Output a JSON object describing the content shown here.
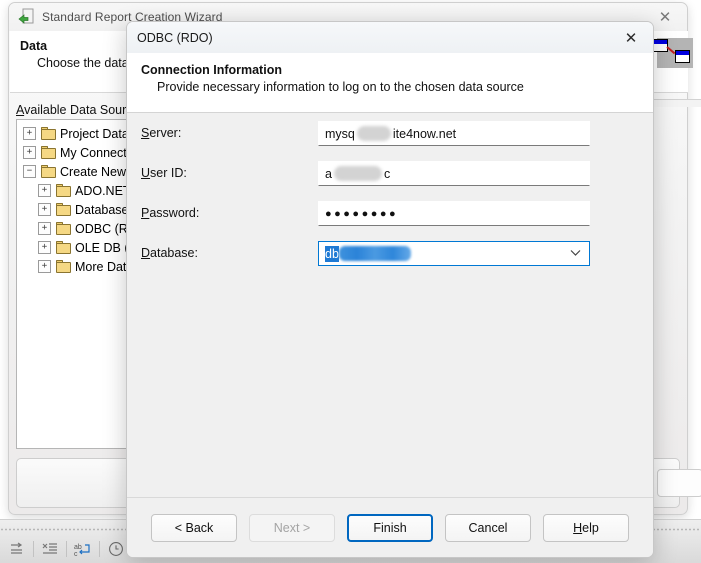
{
  "app_window": {
    "title": "Standard Report Creation Wizard",
    "icon": "report-wizard-icon",
    "close_label": "✕",
    "page": {
      "heading": "Data",
      "subheading": "Choose the data y",
      "sources_label_first": "A",
      "sources_label_rest": "vailable Data Sources:"
    },
    "tree": [
      {
        "label": "Project Data",
        "expander": "+",
        "indent": 0
      },
      {
        "label": "My Connectio",
        "expander": "+",
        "indent": 0
      },
      {
        "label": "Create New Co",
        "expander": "−",
        "indent": 0
      },
      {
        "label": "ADO.NET (",
        "expander": "+",
        "indent": 1
      },
      {
        "label": "Database F",
        "expander": "+",
        "indent": 1
      },
      {
        "label": "ODBC (RD",
        "expander": "+",
        "indent": 1
      },
      {
        "label": "OLE DB (A",
        "expander": "+",
        "indent": 1
      },
      {
        "label": "More Data",
        "expander": "+",
        "indent": 1
      }
    ]
  },
  "dialog": {
    "title": "ODBC (RDO)",
    "close_label": "✕",
    "heading": "Connection Information",
    "subheading": "Provide necessary information to log on to the chosen data source",
    "fields": [
      {
        "label_first": "S",
        "label_rest": "erver:",
        "value_prefix": "mysq",
        "value_suffix": "ite4now.net",
        "redacted": true,
        "type": "text"
      },
      {
        "label_first": "U",
        "label_rest": "ser ID:",
        "value_prefix": "a",
        "value_suffix": "c",
        "redacted": true,
        "type": "text"
      },
      {
        "label_first": "P",
        "label_rest": "assword:",
        "value_prefix": "●●●●●●●●",
        "value_suffix": "",
        "redacted": false,
        "type": "password"
      },
      {
        "label_first": "D",
        "label_rest": "atabase:",
        "value_prefix": "db",
        "value_suffix": "",
        "redacted": true,
        "type": "combo",
        "selected": true,
        "arrow": "⌄"
      }
    ],
    "buttons": [
      {
        "label": "< Back",
        "state": "normal",
        "accel": ""
      },
      {
        "label": "Next >",
        "state": "disabled",
        "accel": ""
      },
      {
        "label": "Finish",
        "state": "default",
        "accel": ""
      },
      {
        "label": "Cancel",
        "state": "normal",
        "accel": ""
      },
      {
        "label": "Help",
        "state": "normal",
        "accel": "H"
      }
    ]
  },
  "toolbar": {
    "icons": [
      {
        "name": "indent-arrow-icon",
        "glyph": "⇥"
      },
      {
        "name": "list-remove-icon",
        "glyph": "≡"
      },
      {
        "name": "abc-wrap-icon",
        "glyph": "ab"
      },
      {
        "name": "clock-icon",
        "glyph": "◴"
      }
    ]
  },
  "colors": {
    "accent": "#0067c0",
    "selection": "#1f7ad4",
    "combo_border": "#0078d4",
    "folder": "#f5d884",
    "window_bg": "#f0f0f0"
  }
}
